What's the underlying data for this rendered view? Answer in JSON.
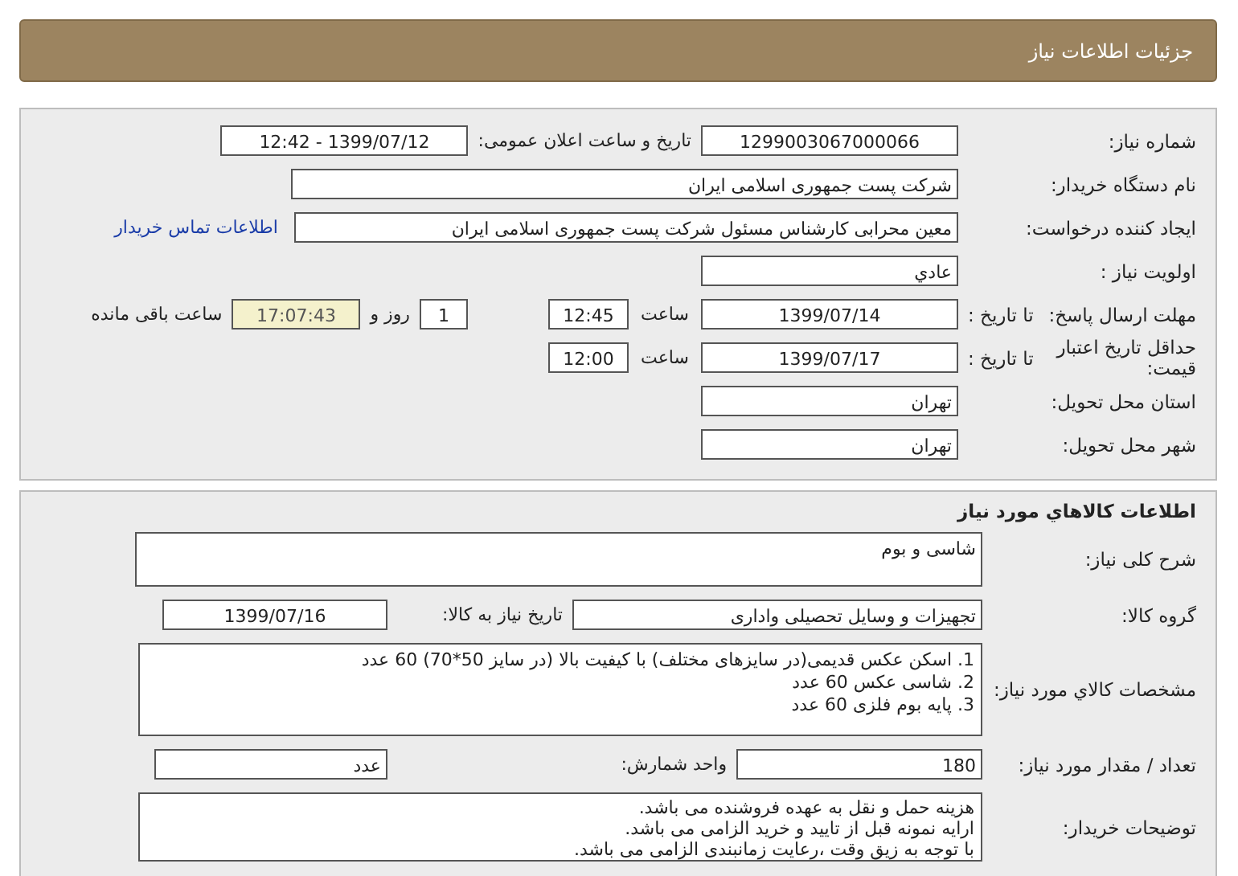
{
  "header": {
    "title": "جزئیات اطلاعات نیاز"
  },
  "general": {
    "need_number": {
      "label": "شماره نیاز:",
      "value": "1299003067000066"
    },
    "announce": {
      "label": "تاریخ و ساعت اعلان عمومی:",
      "value": "1399/07/12 - 12:42"
    },
    "buyer": {
      "label": "نام دستگاه خریدار:",
      "value": "شرکت پست جمهوری اسلامی ایران"
    },
    "creator": {
      "label": "ایجاد کننده درخواست:",
      "value": "معین محرابی  کارشناس مسئول  شرکت پست جمهوری اسلامی ایران",
      "link": "اطلاعات تماس خریدار"
    },
    "priority": {
      "label": "اولویت نیاز :",
      "value": "عادي"
    },
    "deadline": {
      "label": "مهلت ارسال پاسخ:",
      "to_date": "تا تاریخ :",
      "date": "1399/07/14",
      "time_label": "ساعت",
      "time": "12:45",
      "days": "1",
      "days_label": "روز و",
      "remaining": "17:07:43",
      "remaining_label": "ساعت باقی مانده"
    },
    "validity": {
      "label": "حداقل تاریخ اعتبار قیمت:",
      "to_date": "تا تاریخ :",
      "date": "1399/07/17",
      "time_label": "ساعت",
      "time": "12:00"
    },
    "province": {
      "label": "استان محل تحویل:",
      "value": "تهران"
    },
    "city": {
      "label": "شهر محل تحویل:",
      "value": "تهران"
    }
  },
  "goods": {
    "title": "اطلاعات کالاهاي مورد نیاز",
    "summary": {
      "label": "شرح کلی نیاز:",
      "value": "شاسی و بوم"
    },
    "group": {
      "label": "گروه کالا:",
      "value": "تجهیزات و وسایل تحصیلی واداری",
      "date_label": "تاریخ نیاز به کالا:",
      "date": "1399/07/16"
    },
    "specs": {
      "label": "مشخصات کالاي مورد نیاز:",
      "lines": [
        "1. اسکن عکس قدیمی(در سایزهای مختلف) با کیفیت بالا (در سایز 50*70) 60 عدد",
        "2. شاسی عکس 60 عدد",
        "3. پایه بوم فلزی 60 عدد"
      ]
    },
    "quantity": {
      "label": "تعداد / مقدار مورد نیاز:",
      "value": "180",
      "unit_label": "واحد شمارش:",
      "unit": "عدد"
    },
    "notes": {
      "label": "توضیحات خریدار:",
      "lines": [
        "هزینه حمل و نقل به عهده فروشنده می باشد.",
        "ارایه نمونه قبل از تایید و خرید الزامی می باشد.",
        "با توجه به زیق وقت ،رعایت زمانبندی الزامی می باشد."
      ]
    }
  }
}
